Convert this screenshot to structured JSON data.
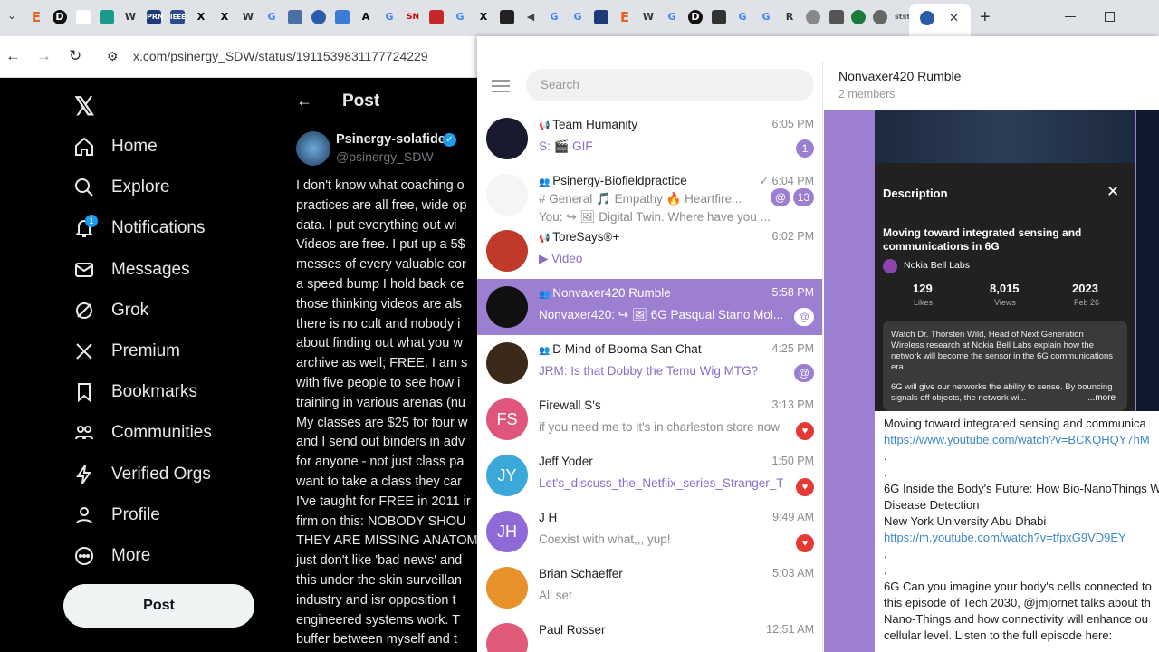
{
  "browser": {
    "url": "x.com/psinergy_SDW/status/1911539831177724229",
    "active_tab_close": "✕",
    "new_tab": "+"
  },
  "x": {
    "nav": [
      {
        "label": "Home",
        "icon": "home-icon"
      },
      {
        "label": "Explore",
        "icon": "search-icon"
      },
      {
        "label": "Notifications",
        "icon": "bell-icon",
        "badge": "1"
      },
      {
        "label": "Messages",
        "icon": "mail-icon"
      },
      {
        "label": "Grok",
        "icon": "grok-icon"
      },
      {
        "label": "Premium",
        "icon": "x-icon"
      },
      {
        "label": "Bookmarks",
        "icon": "bookmark-icon"
      },
      {
        "label": "Communities",
        "icon": "communities-icon"
      },
      {
        "label": "Verified Orgs",
        "icon": "bolt-icon"
      },
      {
        "label": "Profile",
        "icon": "person-icon"
      },
      {
        "label": "More",
        "icon": "more-icon"
      }
    ],
    "post_button": "Post",
    "header": "Post",
    "author": {
      "name": "Psinergy-solafide",
      "handle": "@psinergy_SDW"
    },
    "post_lines": [
      "I don't know what coaching o",
      "practices are all free, wide op",
      "data. I put everything out wi",
      "Videos are free. I put up a 5$",
      "messes of every valuable cor",
      "a speed bump I hold back ce",
      "those thinking videos are als",
      "there is no cult and nobody i",
      "about finding out what you w",
      "archive as well; FREE. I am s",
      "with five people to see how i",
      "training in various arenas (nu",
      "My classes are $25 for four w",
      "and I send out binders in adv",
      "for anyone - not just class pa",
      "want to take a class they car",
      "I've taught for FREE in 2011 ir",
      "firm on this: NOBODY SHOU",
      "THEY ARE MISSING ANATOM",
      "just don't like 'bad news' and",
      "this under the skin surveillan",
      "industry and isr opposition t",
      "engineered systems work. T",
      "buffer between myself and t"
    ]
  },
  "telegram": {
    "search_placeholder": "Search",
    "chats": [
      {
        "name": "Team Humanity",
        "time": "6:05 PM",
        "preview": "S: 🎬 GIF",
        "badge": "1",
        "type": "channel"
      },
      {
        "name": "Psinergy-Biofieldpractice",
        "time": "✓ 6:04 PM",
        "preview": "# General  🎵 Empathy  🔥 Heartfire...",
        "preview2": "You: ↪ 🖼 Digital Twin. Where have you ...",
        "badge": "13",
        "mention": "@",
        "type": "group"
      },
      {
        "name": "ToreSays®+",
        "time": "6:02 PM",
        "preview": "▶ Video",
        "type": "channel"
      },
      {
        "name": "Nonvaxer420 Rumble",
        "time": "5:58 PM",
        "preview": "Nonvaxer420: ↪ 🖼 6G Pasqual Stano Mol...",
        "mention": "@",
        "type": "group",
        "selected": true
      },
      {
        "name": "D Mind of Booma San Chat",
        "time": "4:25 PM",
        "preview": "JRM: Is that Dobby the Temu Wig MTG?",
        "mention": "@",
        "type": "group"
      },
      {
        "name": "Firewall S's",
        "time": "3:13 PM",
        "preview": "if you need me to it's in charleston store now ...",
        "initials": "FS",
        "heart": true
      },
      {
        "name": "Jeff Yoder",
        "time": "1:50 PM",
        "preview": "Let's_discuss_the_Netflix_series_Stranger_Thi...",
        "initials": "JY",
        "heart": true
      },
      {
        "name": "J H",
        "time": "9:49 AM",
        "preview": "Coexist with what,,, yup!",
        "initials": "JH",
        "heart": true
      },
      {
        "name": "Brian Schaeffer",
        "time": "5:03 AM",
        "preview": "All set"
      },
      {
        "name": "Paul Rosser",
        "time": "12:51 AM",
        "preview": ""
      }
    ],
    "header": {
      "title": "Nonvaxer420 Rumble",
      "subtitle": "2 members"
    },
    "video_card": {
      "desc_title": "Description",
      "title": "Moving toward integrated sensing and communications in 6G",
      "channel": "Nokia Bell Labs",
      "likes": "129",
      "likes_label": "Likes",
      "views": "8,015",
      "views_label": "Views",
      "year": "2023",
      "date": "Feb 26",
      "body": "Watch Dr. Thorsten Wild, Head of Next Generation Wireless research at Nokia Bell Labs explain how the network will become the sensor in the 6G communications era.",
      "body2": "6G will give our networks the ability to sense. By bouncing signals off objects, the network wi...",
      "more": "...more"
    },
    "message_lines": [
      {
        "t": "Moving toward integrated sensing and communica",
        "link": false
      },
      {
        "t": "https://www.youtube.com/watch?v=BCKQHQY7hM",
        "link": true
      },
      {
        "t": ".",
        "link": false
      },
      {
        "t": ".",
        "link": false
      },
      {
        "t": "6G Inside the Body's Future: How Bio-NanoThings W",
        "link": false
      },
      {
        "t": "Disease Detection",
        "link": false
      },
      {
        "t": "New York University Abu Dhabi",
        "link": false
      },
      {
        "t": "https://m.youtube.com/watch?v=tfpxG9VD9EY",
        "link": true
      },
      {
        "t": ".",
        "link": false
      },
      {
        "t": ".",
        "link": false
      },
      {
        "t": "6G Can you imagine your body's cells connected to",
        "link": false
      },
      {
        "t": "this episode of Tech 2030, @jmjornet talks about th",
        "link": false
      },
      {
        "t": "Nano-Things and how connectivity will enhance ou",
        "link": false
      },
      {
        "t": "cellular level. Listen to the full episode here:",
        "link": false
      }
    ]
  },
  "colors": {
    "accent": "#9c7fd0",
    "link": "#3e87c8"
  }
}
